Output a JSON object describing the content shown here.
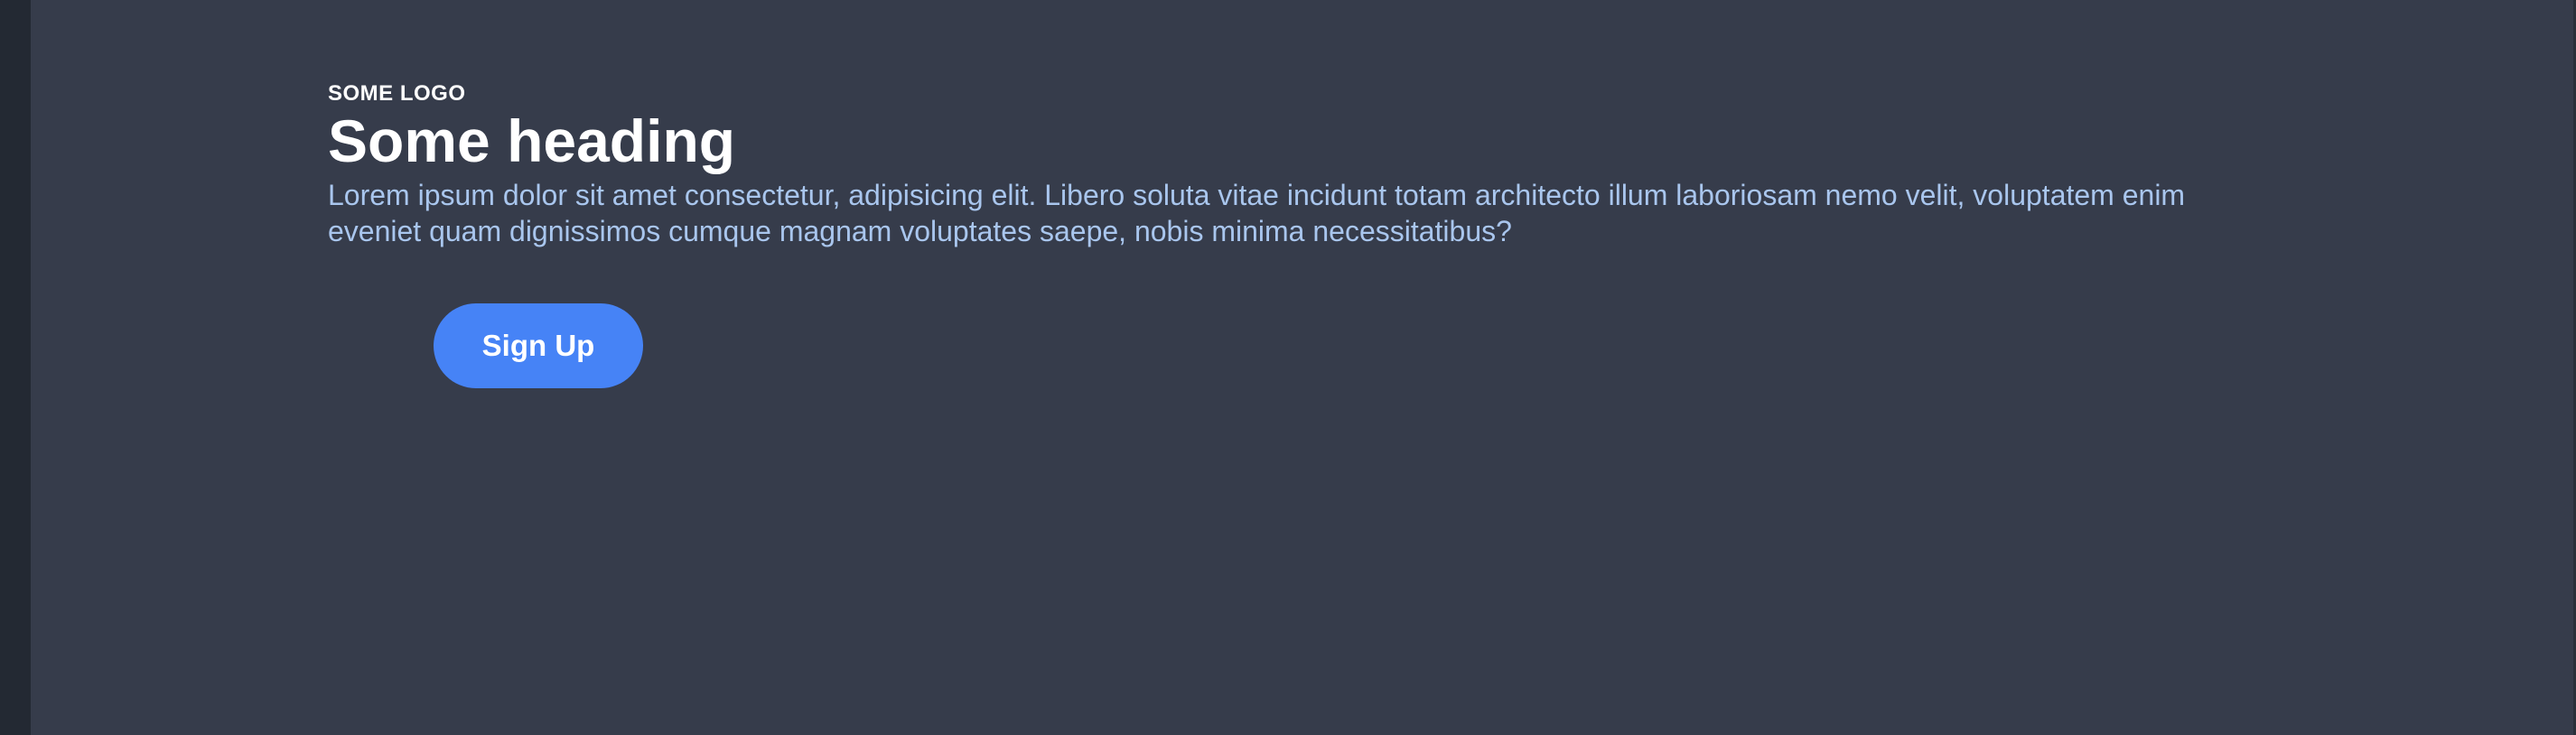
{
  "hero": {
    "logo_text": "SOME LOGO",
    "heading": "Some heading",
    "body": "Lorem ipsum dolor sit amet consectetur, adipisicing elit. Libero soluta vitae incidunt totam architecto illum laboriosam nemo velit, voluptatem enim eveniet quam dignissimos cumque magnam voluptates saepe, nobis minima necessitatibus?",
    "cta_label": "Sign Up"
  },
  "colors": {
    "background": "#363c4b",
    "sidebar_strip": "#232933",
    "heading_text": "#ffffff",
    "body_text": "#a9c6ee",
    "button_bg": "#4683f6",
    "button_text": "#ffffff"
  }
}
